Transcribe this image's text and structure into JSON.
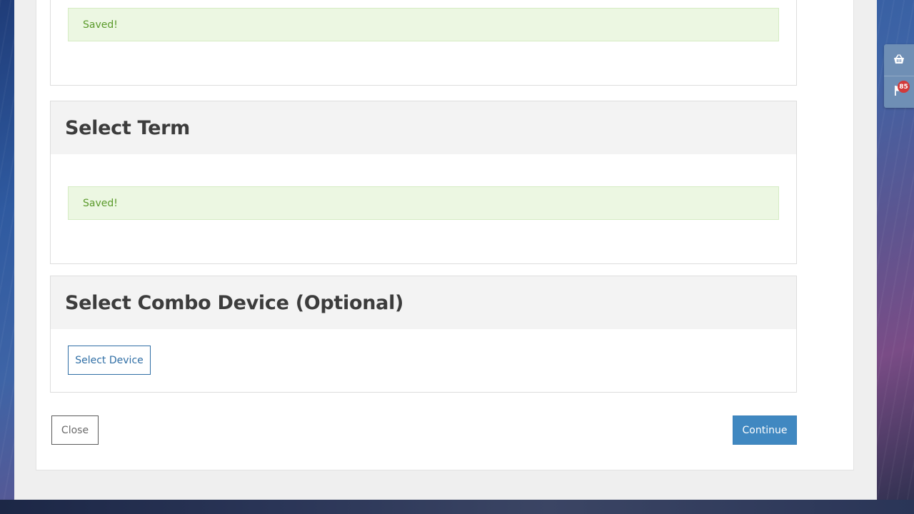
{
  "sections": {
    "previous": {
      "alert_text": "Saved!"
    },
    "term": {
      "title": "Select Term",
      "alert_text": "Saved!"
    },
    "combo": {
      "title": "Select Combo Device (Optional)",
      "select_device_label": "Select Device"
    }
  },
  "footer": {
    "close_label": "Close",
    "continue_label": "Continue"
  },
  "side_toolbar": {
    "basket_icon": "basket-icon",
    "flag_icon": "flag-icon",
    "notification_count": "85"
  },
  "colors": {
    "primary": "#4088c1",
    "success_text": "#5a9a2a",
    "success_bg": "#ecf7e2",
    "badge": "#d23a3a",
    "toolbar": "#6f8fb5"
  }
}
